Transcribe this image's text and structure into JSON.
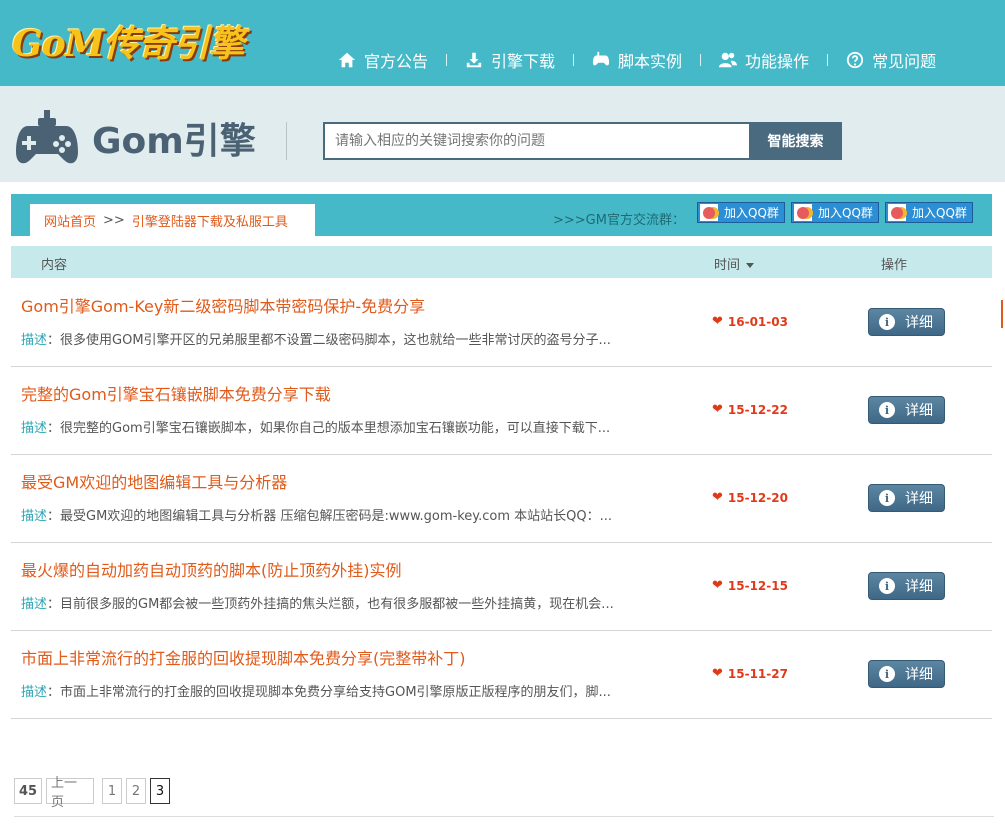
{
  "header": {
    "logo_text": "GoM传奇引擎",
    "nav": [
      {
        "label": "官方公告",
        "icon": "home-icon"
      },
      {
        "label": "引擎下载",
        "icon": "download-icon"
      },
      {
        "label": "脚本实例",
        "icon": "gamepad-icon"
      },
      {
        "label": "功能操作",
        "icon": "users-icon"
      },
      {
        "label": "常见问题",
        "icon": "question-icon"
      }
    ]
  },
  "search": {
    "brand_title": "Gom引擎",
    "placeholder": "请输入相应的关键词搜索你的问题",
    "button_label": "智能搜索"
  },
  "breadcrumb": {
    "home": "网站首页",
    "separator": ">>",
    "current": "引擎登陆器下载及私服工具"
  },
  "qq": {
    "label": ">>>GM官方交流群：",
    "buttons": [
      "加入QQ群",
      "加入QQ群",
      "加入QQ群"
    ]
  },
  "table": {
    "col_content": "内容",
    "col_time": "时间",
    "col_action": "操作",
    "desc_label": "描述",
    "detail_label": "详细",
    "rows": [
      {
        "title": "Gom引擎Gom-Key新二级密码脚本带密码保护-免费分享",
        "desc": "：很多使用GOM引擎开区的兄弟服里都不设置二级密码脚本，这也就给一些非常讨厌的盗号分子...",
        "date": "16-01-03"
      },
      {
        "title": "完整的Gom引擎宝石镶嵌脚本免费分享下载",
        "desc": "：很完整的Gom引擎宝石镶嵌脚本，如果你自己的版本里想添加宝石镶嵌功能，可以直接下载下...",
        "date": "15-12-22"
      },
      {
        "title": "最受GM欢迎的地图编辑工具与分析器",
        "desc": "：最受GM欢迎的地图编辑工具与分析器 压缩包解压密码是:www.gom-key.com 本站站长QQ：...",
        "date": "15-12-20"
      },
      {
        "title": "最火爆的自动加药自动顶药的脚本(防止顶药外挂)实例",
        "desc": "：目前很多服的GM都会被一些顶药外挂搞的焦头烂额，也有很多服都被一些外挂搞黄，现在机会...",
        "date": "15-12-15"
      },
      {
        "title": "市面上非常流行的打金服的回收提现脚本免费分享(完整带补丁)",
        "desc": "：市面上非常流行的打金服的回收提现脚本免费分享给支持GOM引擎原版正版程序的朋友们，脚...",
        "date": "15-11-27"
      }
    ]
  },
  "pager": {
    "total": "45",
    "prev": "上一页",
    "pages": [
      "1",
      "2",
      "3"
    ],
    "current": "3"
  },
  "colors": {
    "topbar": "#46b9c8",
    "accent_orange": "#e05a1a",
    "button_blue": "#4a6a80"
  }
}
